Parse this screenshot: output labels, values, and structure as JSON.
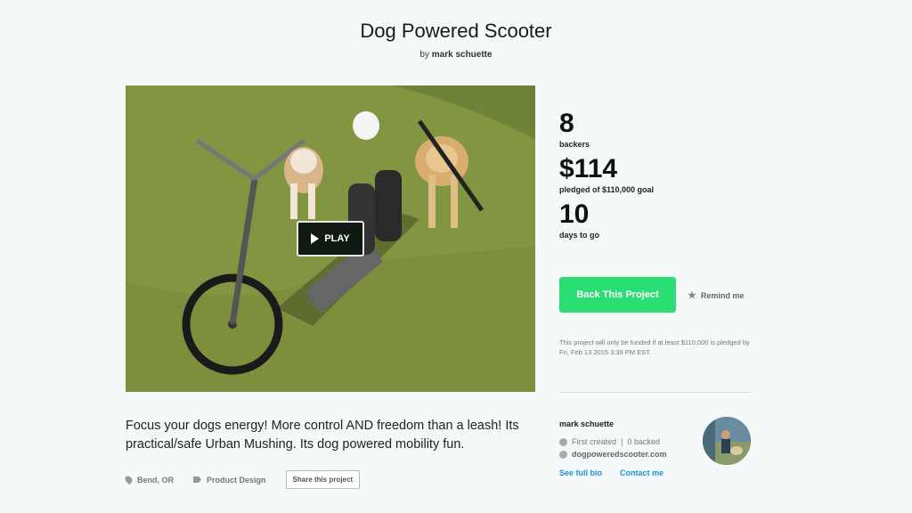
{
  "project": {
    "title": "Dog Powered Scooter",
    "by_prefix": "by",
    "creator": "mark schuette"
  },
  "video": {
    "play_label": "PLAY"
  },
  "stats": {
    "backers": "8",
    "backers_label": "backers",
    "pledged": "$114",
    "pledged_label": "pledged of $110,000 goal",
    "days": "10",
    "days_label": "days to go"
  },
  "actions": {
    "back_label": "Back This Project",
    "remind_label": "Remind me"
  },
  "funding_note": "This project will only be funded if at least $110,000 is pledged by Fri, Feb 13 2015 3:39 PM EST.",
  "creator_card": {
    "name": "mark schuette",
    "first_created": "First created",
    "separator": "|",
    "backed": "0 backed",
    "website": "dogpoweredscooter.com",
    "bio_link": "See full bio",
    "contact_link": "Contact me"
  },
  "blurb": "Focus your dogs energy! More control AND freedom than a leash! Its practical/safe Urban Mushing. Its dog powered mobility fun.",
  "meta": {
    "location": "Bend, OR",
    "category": "Product Design",
    "share_label": "Share this project"
  },
  "colors": {
    "accent_green": "#2bde73",
    "link_blue": "#1a93d6"
  },
  "icons": [
    "play-icon",
    "star-icon",
    "clock-icon",
    "globe-icon",
    "location-pin-icon",
    "tag-icon"
  ]
}
